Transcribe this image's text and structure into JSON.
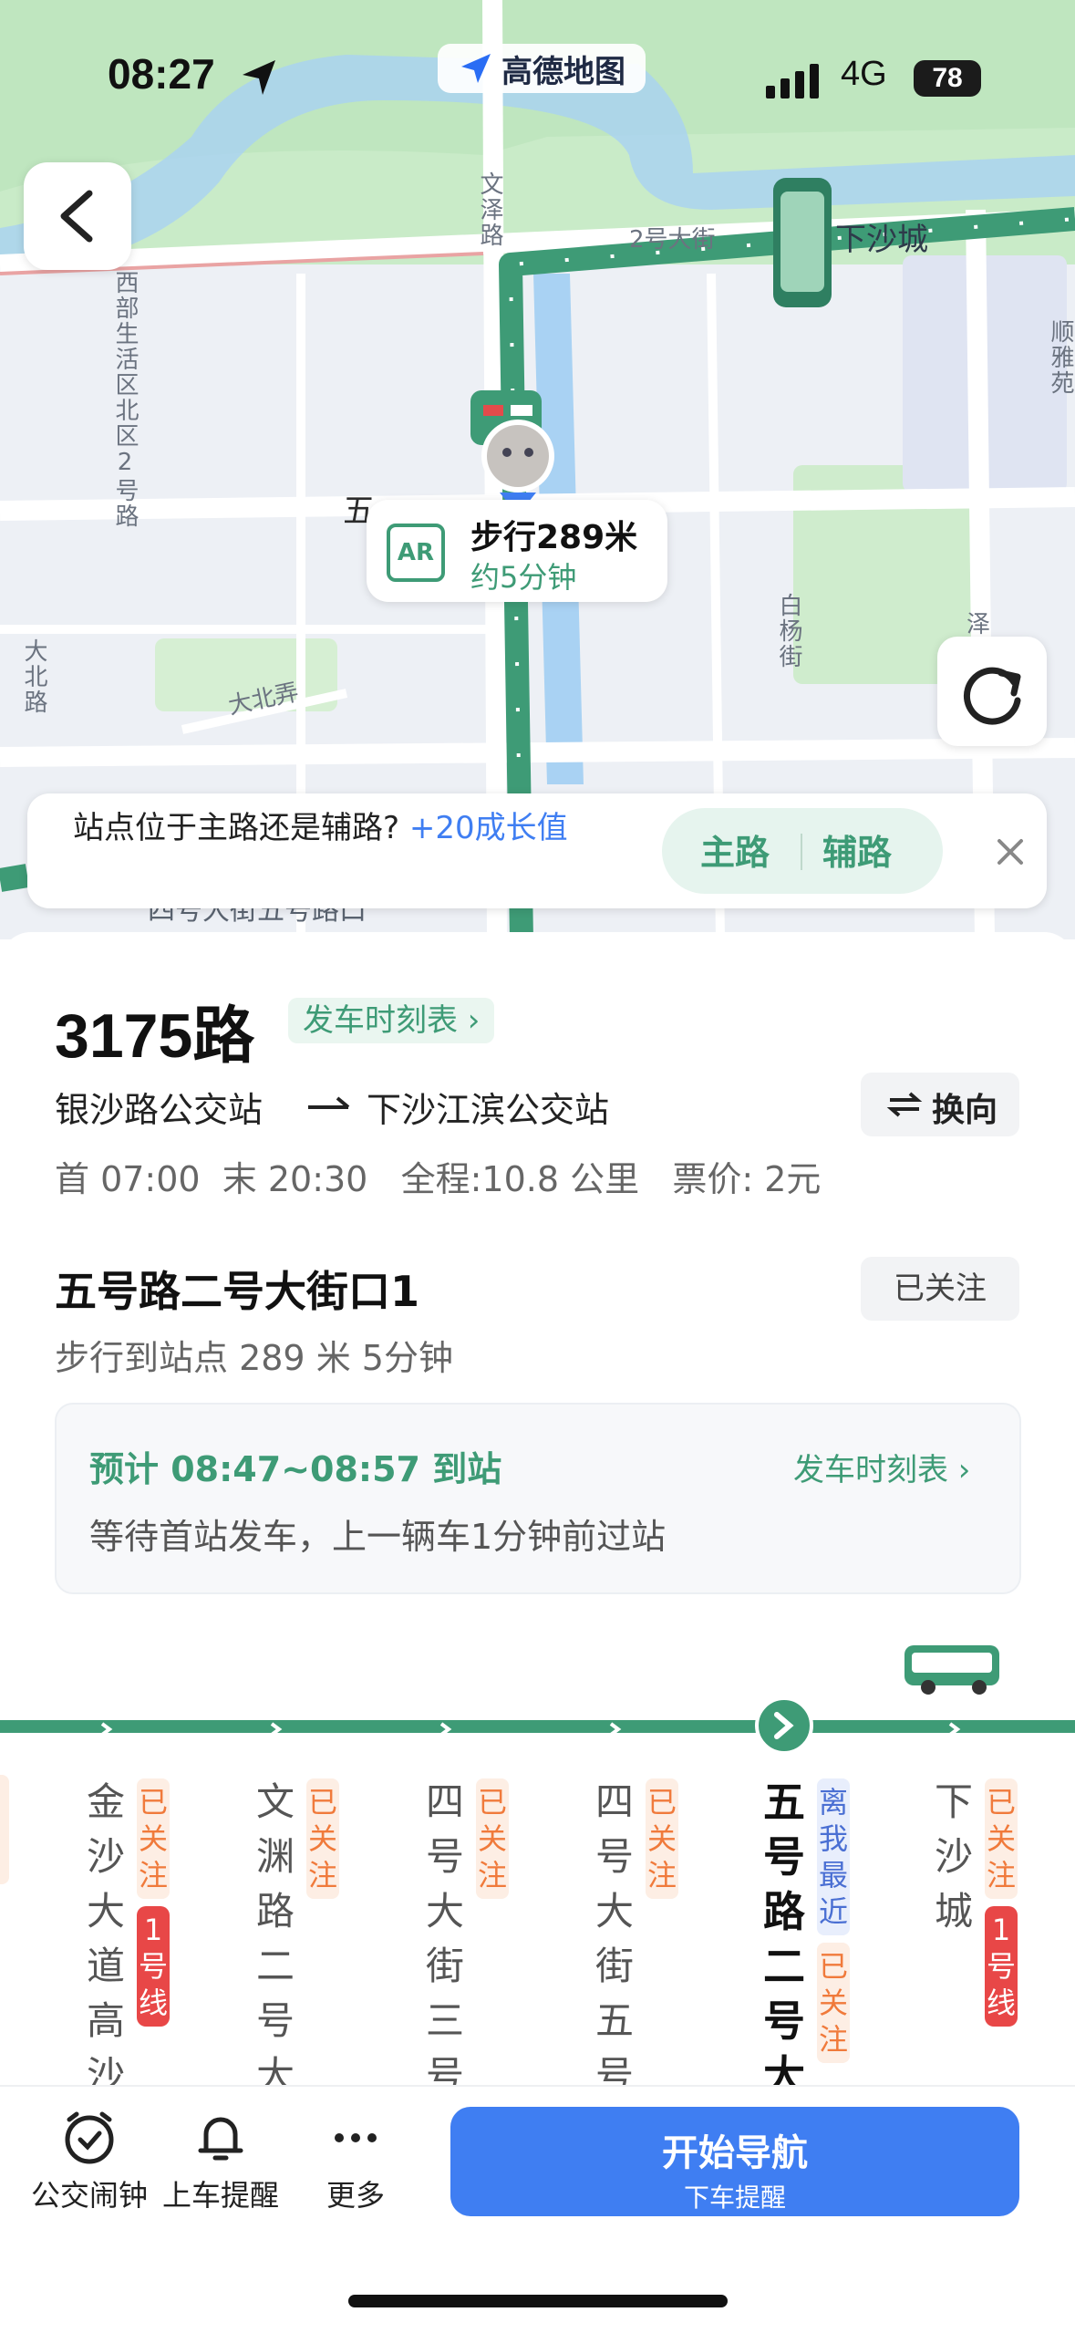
{
  "status": {
    "time": "08:27",
    "network": "4G",
    "battery": "78"
  },
  "app_pill": "高德地图",
  "map": {
    "labels": {
      "wenze_road": "文泽路",
      "xiasha_city": "下沙城",
      "road_2": "2号大街",
      "west_district": "西部生活区北区2号路",
      "shun": "顺雅苑",
      "five": "五",
      "baiyang": "白杨街",
      "ze": "泽",
      "dabei_road": "大北路",
      "dabei_lane": "大北弄",
      "bottom_road": "四号大街五号路口"
    },
    "walk_card": {
      "ar": "AR",
      "distance": "步行289米",
      "time": "约5分钟"
    }
  },
  "prompt": {
    "question": "站点位于主路还是辅路?",
    "reward": "+20成长值",
    "option_main": "主路",
    "option_aux": "辅路"
  },
  "route": {
    "name": "3175路",
    "timetable_link": "发车时刻表",
    "from": "银沙路公交站",
    "to": "下沙江滨公交站",
    "switch_label": "换向",
    "first": "首 07:00",
    "last": "末 20:30",
    "distance": "全程:10.8 公里",
    "fare": "票价: 2元"
  },
  "stop": {
    "name": "五号路二号大街口1",
    "followed": "已关注",
    "walk_info": "步行到站点 289 米 5分钟",
    "eta": "预计 08:47~08:57 到站",
    "eta_link": "发车时刻表",
    "note": "等待首站发车，上一辆车1分钟前过站"
  },
  "stations": [
    {
      "name": "金沙大道高沙",
      "tags": [
        "已关注"
      ],
      "line": "1号线"
    },
    {
      "name": "文渊路二号大",
      "tags": [
        "已关注"
      ]
    },
    {
      "name": "四号大街三号",
      "tags": [
        "已关注"
      ]
    },
    {
      "name": "四号大街五号",
      "tags": [
        "已关注"
      ]
    },
    {
      "name": "五号路二号大",
      "tags": [
        "离我最近",
        "已关注"
      ],
      "current": true
    },
    {
      "name": "下沙城",
      "tags": [
        "已关注"
      ],
      "line": "1号线"
    }
  ],
  "bottom": {
    "alarm": "公交闹钟",
    "remind": "上车提醒",
    "more": "更多",
    "nav_title": "开始导航",
    "nav_sub": "下车提醒"
  },
  "colors": {
    "route_green": "#3e9b76",
    "accent_blue": "#3f7ef2",
    "orange": "#f07a3b"
  }
}
